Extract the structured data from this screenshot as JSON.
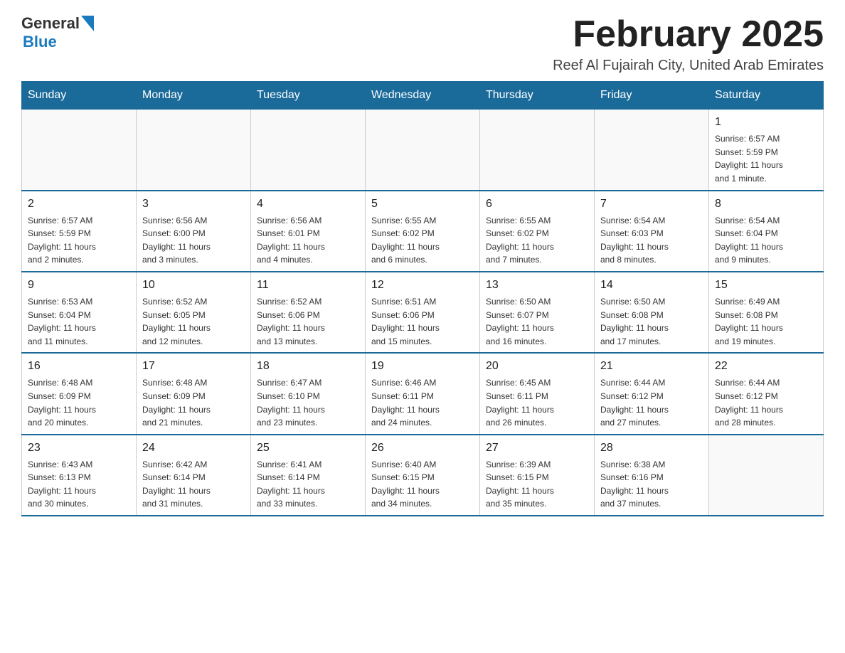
{
  "header": {
    "logo_general": "General",
    "logo_blue": "Blue",
    "title": "February 2025",
    "subtitle": "Reef Al Fujairah City, United Arab Emirates"
  },
  "weekdays": [
    "Sunday",
    "Monday",
    "Tuesday",
    "Wednesday",
    "Thursday",
    "Friday",
    "Saturday"
  ],
  "weeks": [
    [
      {
        "day": "",
        "info": ""
      },
      {
        "day": "",
        "info": ""
      },
      {
        "day": "",
        "info": ""
      },
      {
        "day": "",
        "info": ""
      },
      {
        "day": "",
        "info": ""
      },
      {
        "day": "",
        "info": ""
      },
      {
        "day": "1",
        "info": "Sunrise: 6:57 AM\nSunset: 5:59 PM\nDaylight: 11 hours\nand 1 minute."
      }
    ],
    [
      {
        "day": "2",
        "info": "Sunrise: 6:57 AM\nSunset: 5:59 PM\nDaylight: 11 hours\nand 2 minutes."
      },
      {
        "day": "3",
        "info": "Sunrise: 6:56 AM\nSunset: 6:00 PM\nDaylight: 11 hours\nand 3 minutes."
      },
      {
        "day": "4",
        "info": "Sunrise: 6:56 AM\nSunset: 6:01 PM\nDaylight: 11 hours\nand 4 minutes."
      },
      {
        "day": "5",
        "info": "Sunrise: 6:55 AM\nSunset: 6:02 PM\nDaylight: 11 hours\nand 6 minutes."
      },
      {
        "day": "6",
        "info": "Sunrise: 6:55 AM\nSunset: 6:02 PM\nDaylight: 11 hours\nand 7 minutes."
      },
      {
        "day": "7",
        "info": "Sunrise: 6:54 AM\nSunset: 6:03 PM\nDaylight: 11 hours\nand 8 minutes."
      },
      {
        "day": "8",
        "info": "Sunrise: 6:54 AM\nSunset: 6:04 PM\nDaylight: 11 hours\nand 9 minutes."
      }
    ],
    [
      {
        "day": "9",
        "info": "Sunrise: 6:53 AM\nSunset: 6:04 PM\nDaylight: 11 hours\nand 11 minutes."
      },
      {
        "day": "10",
        "info": "Sunrise: 6:52 AM\nSunset: 6:05 PM\nDaylight: 11 hours\nand 12 minutes."
      },
      {
        "day": "11",
        "info": "Sunrise: 6:52 AM\nSunset: 6:06 PM\nDaylight: 11 hours\nand 13 minutes."
      },
      {
        "day": "12",
        "info": "Sunrise: 6:51 AM\nSunset: 6:06 PM\nDaylight: 11 hours\nand 15 minutes."
      },
      {
        "day": "13",
        "info": "Sunrise: 6:50 AM\nSunset: 6:07 PM\nDaylight: 11 hours\nand 16 minutes."
      },
      {
        "day": "14",
        "info": "Sunrise: 6:50 AM\nSunset: 6:08 PM\nDaylight: 11 hours\nand 17 minutes."
      },
      {
        "day": "15",
        "info": "Sunrise: 6:49 AM\nSunset: 6:08 PM\nDaylight: 11 hours\nand 19 minutes."
      }
    ],
    [
      {
        "day": "16",
        "info": "Sunrise: 6:48 AM\nSunset: 6:09 PM\nDaylight: 11 hours\nand 20 minutes."
      },
      {
        "day": "17",
        "info": "Sunrise: 6:48 AM\nSunset: 6:09 PM\nDaylight: 11 hours\nand 21 minutes."
      },
      {
        "day": "18",
        "info": "Sunrise: 6:47 AM\nSunset: 6:10 PM\nDaylight: 11 hours\nand 23 minutes."
      },
      {
        "day": "19",
        "info": "Sunrise: 6:46 AM\nSunset: 6:11 PM\nDaylight: 11 hours\nand 24 minutes."
      },
      {
        "day": "20",
        "info": "Sunrise: 6:45 AM\nSunset: 6:11 PM\nDaylight: 11 hours\nand 26 minutes."
      },
      {
        "day": "21",
        "info": "Sunrise: 6:44 AM\nSunset: 6:12 PM\nDaylight: 11 hours\nand 27 minutes."
      },
      {
        "day": "22",
        "info": "Sunrise: 6:44 AM\nSunset: 6:12 PM\nDaylight: 11 hours\nand 28 minutes."
      }
    ],
    [
      {
        "day": "23",
        "info": "Sunrise: 6:43 AM\nSunset: 6:13 PM\nDaylight: 11 hours\nand 30 minutes."
      },
      {
        "day": "24",
        "info": "Sunrise: 6:42 AM\nSunset: 6:14 PM\nDaylight: 11 hours\nand 31 minutes."
      },
      {
        "day": "25",
        "info": "Sunrise: 6:41 AM\nSunset: 6:14 PM\nDaylight: 11 hours\nand 33 minutes."
      },
      {
        "day": "26",
        "info": "Sunrise: 6:40 AM\nSunset: 6:15 PM\nDaylight: 11 hours\nand 34 minutes."
      },
      {
        "day": "27",
        "info": "Sunrise: 6:39 AM\nSunset: 6:15 PM\nDaylight: 11 hours\nand 35 minutes."
      },
      {
        "day": "28",
        "info": "Sunrise: 6:38 AM\nSunset: 6:16 PM\nDaylight: 11 hours\nand 37 minutes."
      },
      {
        "day": "",
        "info": ""
      }
    ]
  ]
}
